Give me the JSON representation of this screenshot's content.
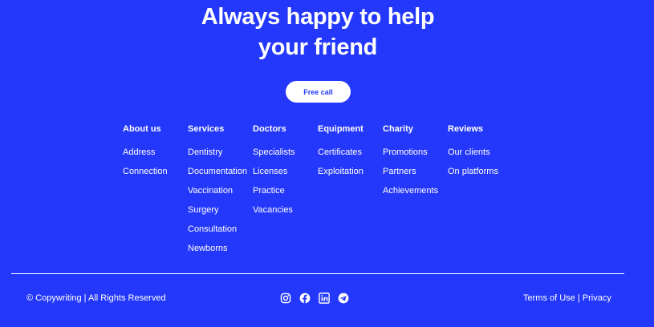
{
  "hero": {
    "line1": "Always happy to help",
    "line2": "your friend",
    "cta_label": "Free call"
  },
  "columns": [
    {
      "title": "About us",
      "items": [
        "Address",
        "Connection"
      ]
    },
    {
      "title": "Services",
      "items": [
        "Dentistry",
        "Documentation",
        "Vaccination",
        "Surgery",
        "Consultation",
        "Newborns"
      ]
    },
    {
      "title": "Doctors",
      "items": [
        "Specialists",
        "Licenses",
        "Practice",
        "Vacancies"
      ]
    },
    {
      "title": "Equipment",
      "items": [
        "Certificates",
        "Exploitation"
      ]
    },
    {
      "title": "Charity",
      "items": [
        "Promotions",
        "Partners",
        "Achievements"
      ]
    },
    {
      "title": "Reviews",
      "items": [
        "Our clients",
        "On platforms"
      ]
    }
  ],
  "footer": {
    "copyright": "© Copywriting | All Rights Reserved",
    "terms_label": "Terms of Use",
    "separator": " | ",
    "privacy_label": "Privacy",
    "social_icons": [
      "instagram-icon",
      "facebook-icon",
      "linkedin-icon",
      "telegram-icon"
    ]
  },
  "colors": {
    "background": "#2438fb",
    "text": "#ffffff",
    "button_bg": "#ffffff",
    "button_text": "#2438fb"
  }
}
